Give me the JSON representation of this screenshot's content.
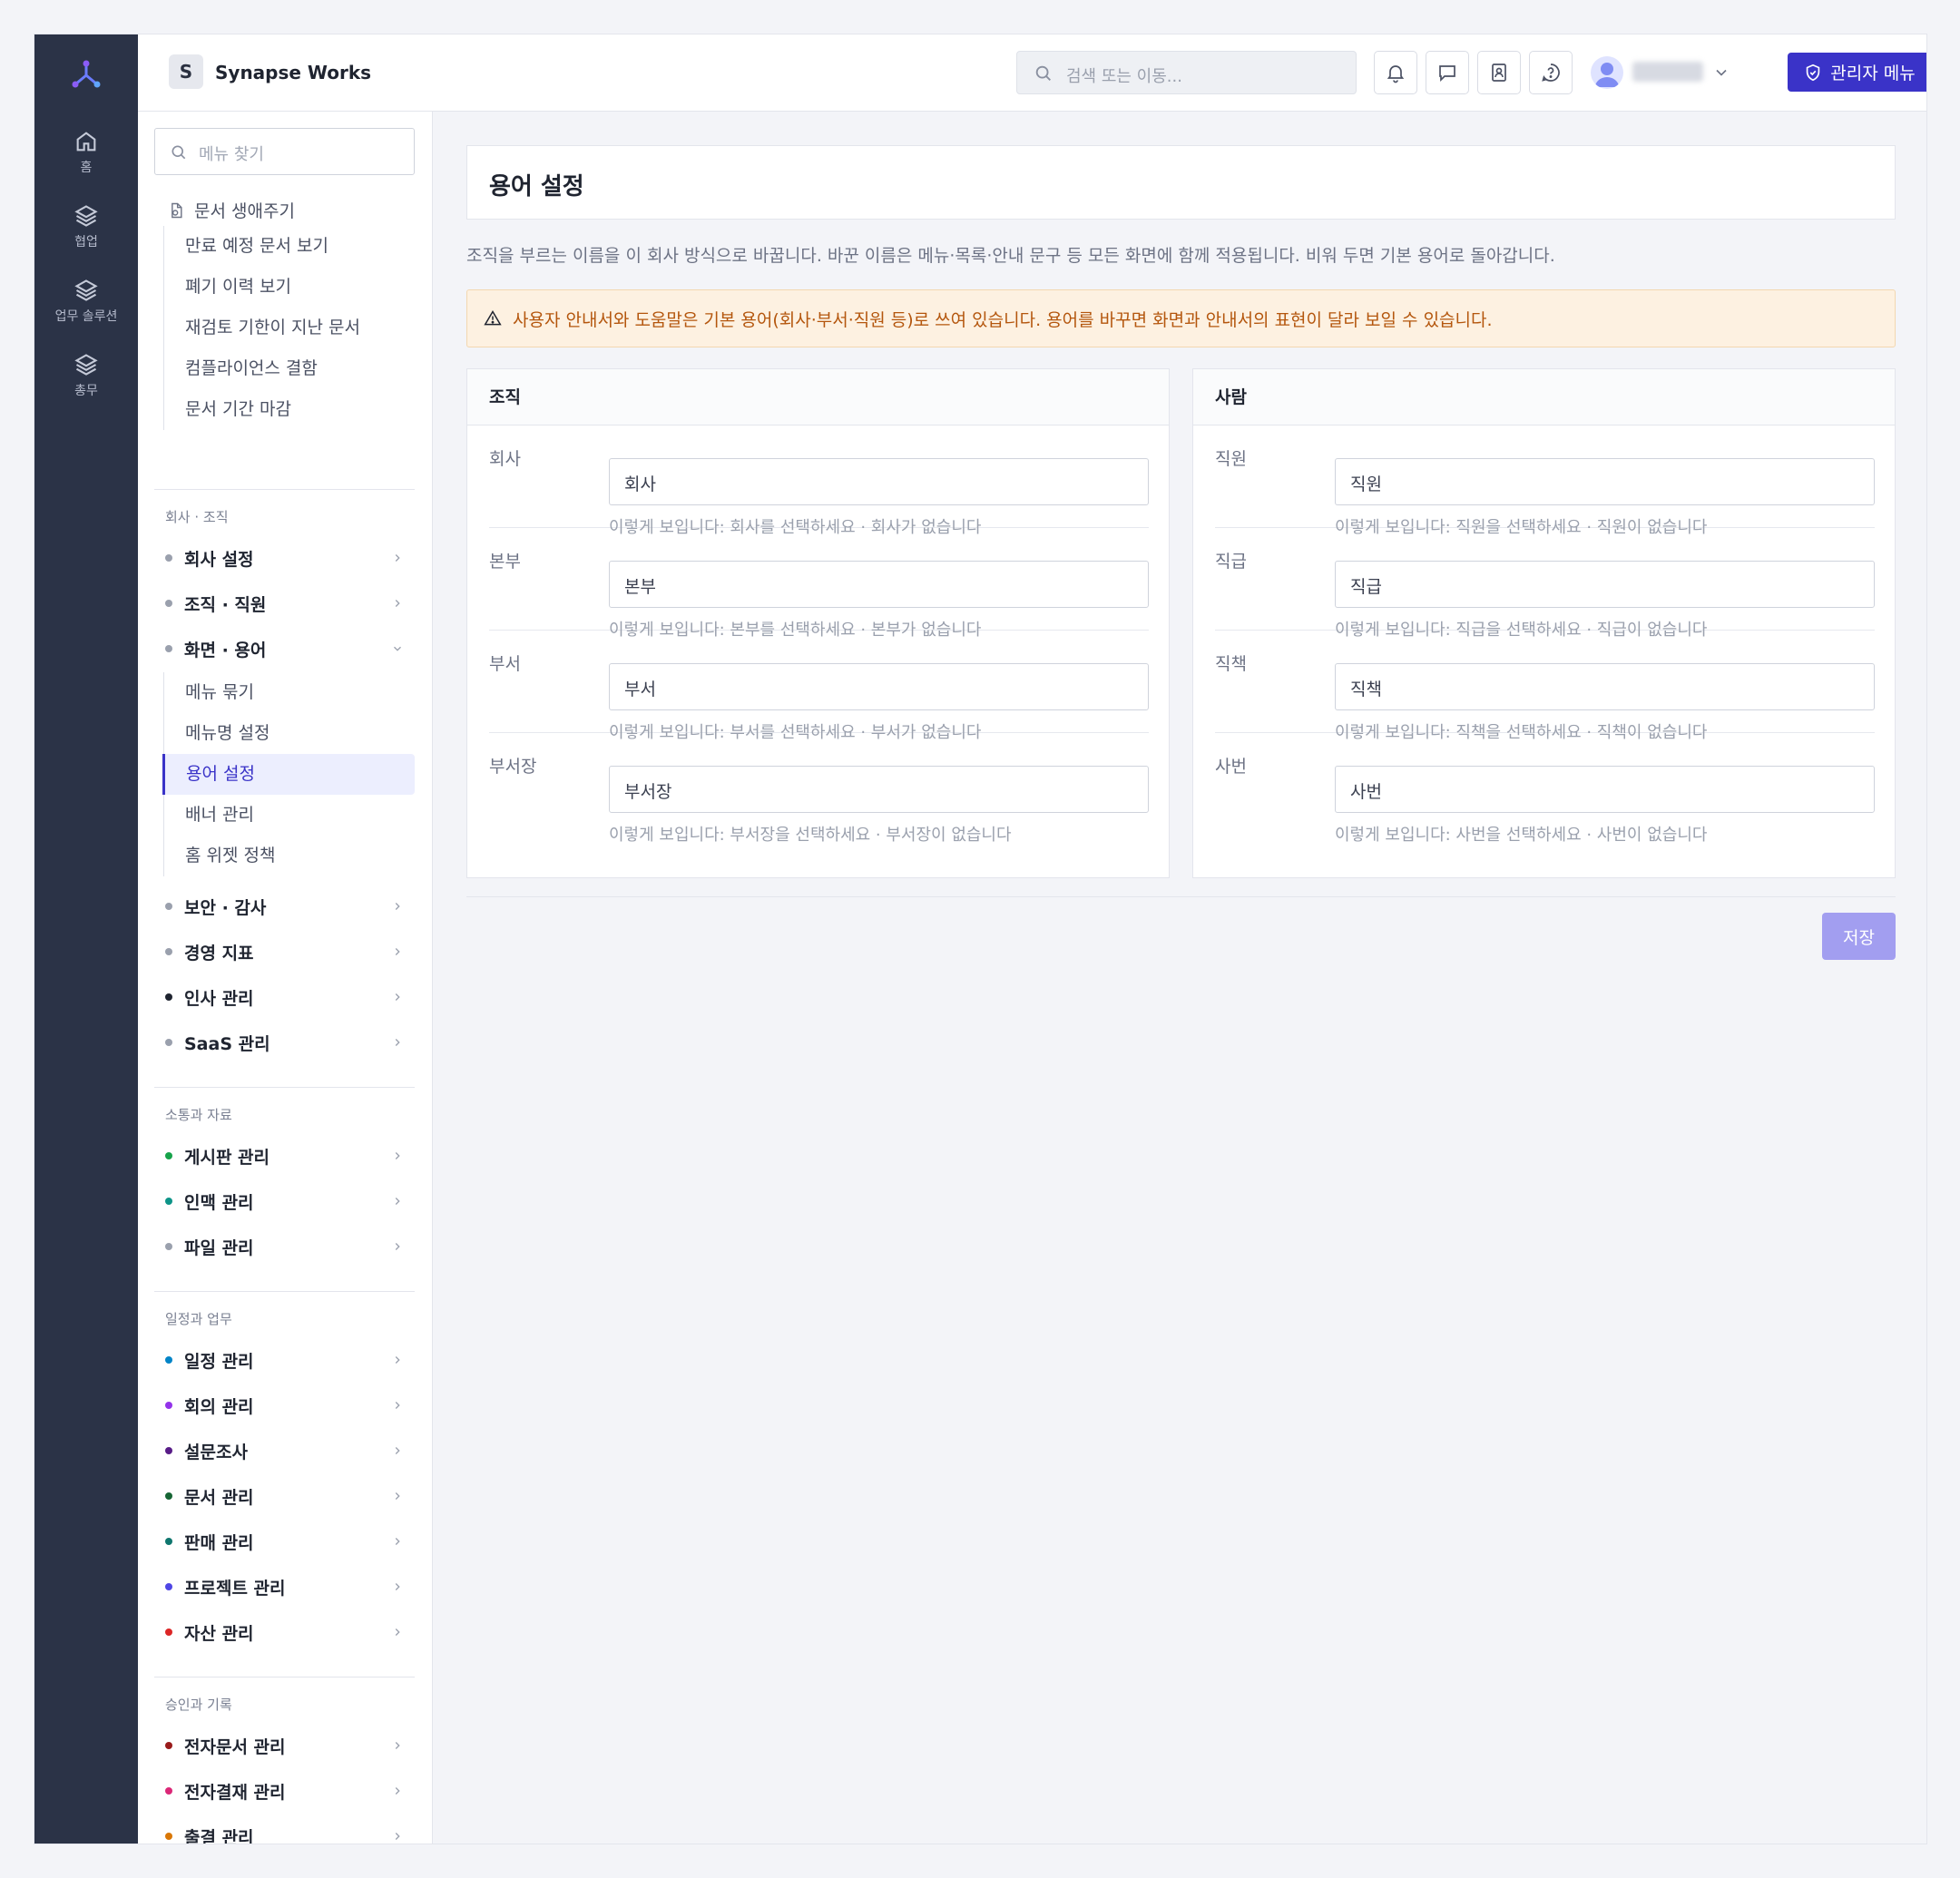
{
  "rail": {
    "items": [
      {
        "label": "홈",
        "icon": "home-icon"
      },
      {
        "label": "협업",
        "icon": "layers-icon"
      },
      {
        "label": "업무 솔루션",
        "icon": "layers-icon"
      },
      {
        "label": "총무",
        "icon": "layers-icon"
      }
    ]
  },
  "topbar": {
    "workspace_badge": "S",
    "workspace_name": "Synapse Works",
    "search_placeholder": "검색 또는 이동...",
    "admin_button": "관리자 메뉴"
  },
  "sidebar": {
    "search_placeholder": "메뉴 찾기",
    "lifecycle": {
      "label": "문서 생애주기",
      "items": [
        "만료 예정 문서 보기",
        "폐기 이력 보기",
        "재검토 기한이 지난 문서",
        "컴플라이언스 결함",
        "문서 기간 마감"
      ]
    },
    "group1": {
      "title": "회사 · 조직",
      "items": [
        {
          "label": "회사 설정",
          "color": "#9aa0ad"
        },
        {
          "label": "조직 · 직원",
          "color": "#9aa0ad"
        },
        {
          "label": "화면 · 용어",
          "color": "#9aa0ad"
        }
      ],
      "sub_items": [
        "메뉴 묶기",
        "메뉴명 설정",
        "용어 설정",
        "배너 관리",
        "홈 위젯 정책"
      ],
      "after": [
        {
          "label": "보안 · 감사",
          "color": "#9aa0ad"
        },
        {
          "label": "경영 지표",
          "color": "#9aa0ad"
        },
        {
          "label": "인사 관리",
          "color": "#1f2430"
        },
        {
          "label": "SaaS 관리",
          "color": "#9aa0ad"
        }
      ]
    },
    "group2": {
      "title": "소통과 자료",
      "items": [
        {
          "label": "게시판 관리",
          "color": "#16a34a"
        },
        {
          "label": "인맥 관리",
          "color": "#0d9488"
        },
        {
          "label": "파일 관리",
          "color": "#9aa0ad"
        }
      ]
    },
    "group3": {
      "title": "일정과 업무",
      "items": [
        {
          "label": "일정 관리",
          "color": "#0284c7"
        },
        {
          "label": "회의 관리",
          "color": "#9333ea"
        },
        {
          "label": "설문조사",
          "color": "#581c87"
        },
        {
          "label": "문서 관리",
          "color": "#166534"
        },
        {
          "label": "판매 관리",
          "color": "#0f766e"
        },
        {
          "label": "프로젝트 관리",
          "color": "#4f46e5"
        },
        {
          "label": "자산 관리",
          "color": "#dc2626"
        }
      ]
    },
    "group4": {
      "title": "승인과 기록",
      "items": [
        {
          "label": "전자문서 관리",
          "color": "#991b1b"
        },
        {
          "label": "전자결재 관리",
          "color": "#db2777"
        },
        {
          "label": "출결 관리",
          "color": "#d97706"
        }
      ]
    }
  },
  "main": {
    "title": "용어 설정",
    "description": "조직을 부르는 이름을 이 회사 방식으로 바꿉니다. 바꾼 이름은 메뉴·목록·안내 문구 등 모든 화면에 함께 적용됩니다. 비워 두면 기본 용어로 돌아갑니다.",
    "warning": "사용자 안내서와 도움말은 기본 용어(회사·부서·직원 등)로 쓰여 있습니다. 용어를 바꾸면 화면과 안내서의 표현이 달라 보일 수 있습니다.",
    "org_panel": {
      "title": "조직",
      "rows": [
        {
          "label": "회사",
          "value": "회사",
          "hint": "이렇게 보입니다: 회사를 선택하세요 · 회사가 없습니다"
        },
        {
          "label": "본부",
          "value": "본부",
          "hint": "이렇게 보입니다: 본부를 선택하세요 · 본부가 없습니다"
        },
        {
          "label": "부서",
          "value": "부서",
          "hint": "이렇게 보입니다: 부서를 선택하세요 · 부서가 없습니다"
        },
        {
          "label": "부서장",
          "value": "부서장",
          "hint": "이렇게 보입니다: 부서장을 선택하세요 · 부서장이 없습니다"
        }
      ]
    },
    "people_panel": {
      "title": "사람",
      "rows": [
        {
          "label": "직원",
          "value": "직원",
          "hint": "이렇게 보입니다: 직원을 선택하세요 · 직원이 없습니다"
        },
        {
          "label": "직급",
          "value": "직급",
          "hint": "이렇게 보입니다: 직급을 선택하세요 · 직급이 없습니다"
        },
        {
          "label": "직책",
          "value": "직책",
          "hint": "이렇게 보입니다: 직책을 선택하세요 · 직책이 없습니다"
        },
        {
          "label": "사번",
          "value": "사번",
          "hint": "이렇게 보입니다: 사번을 선택하세요 · 사번이 없습니다"
        }
      ]
    },
    "save_button": "저장"
  }
}
